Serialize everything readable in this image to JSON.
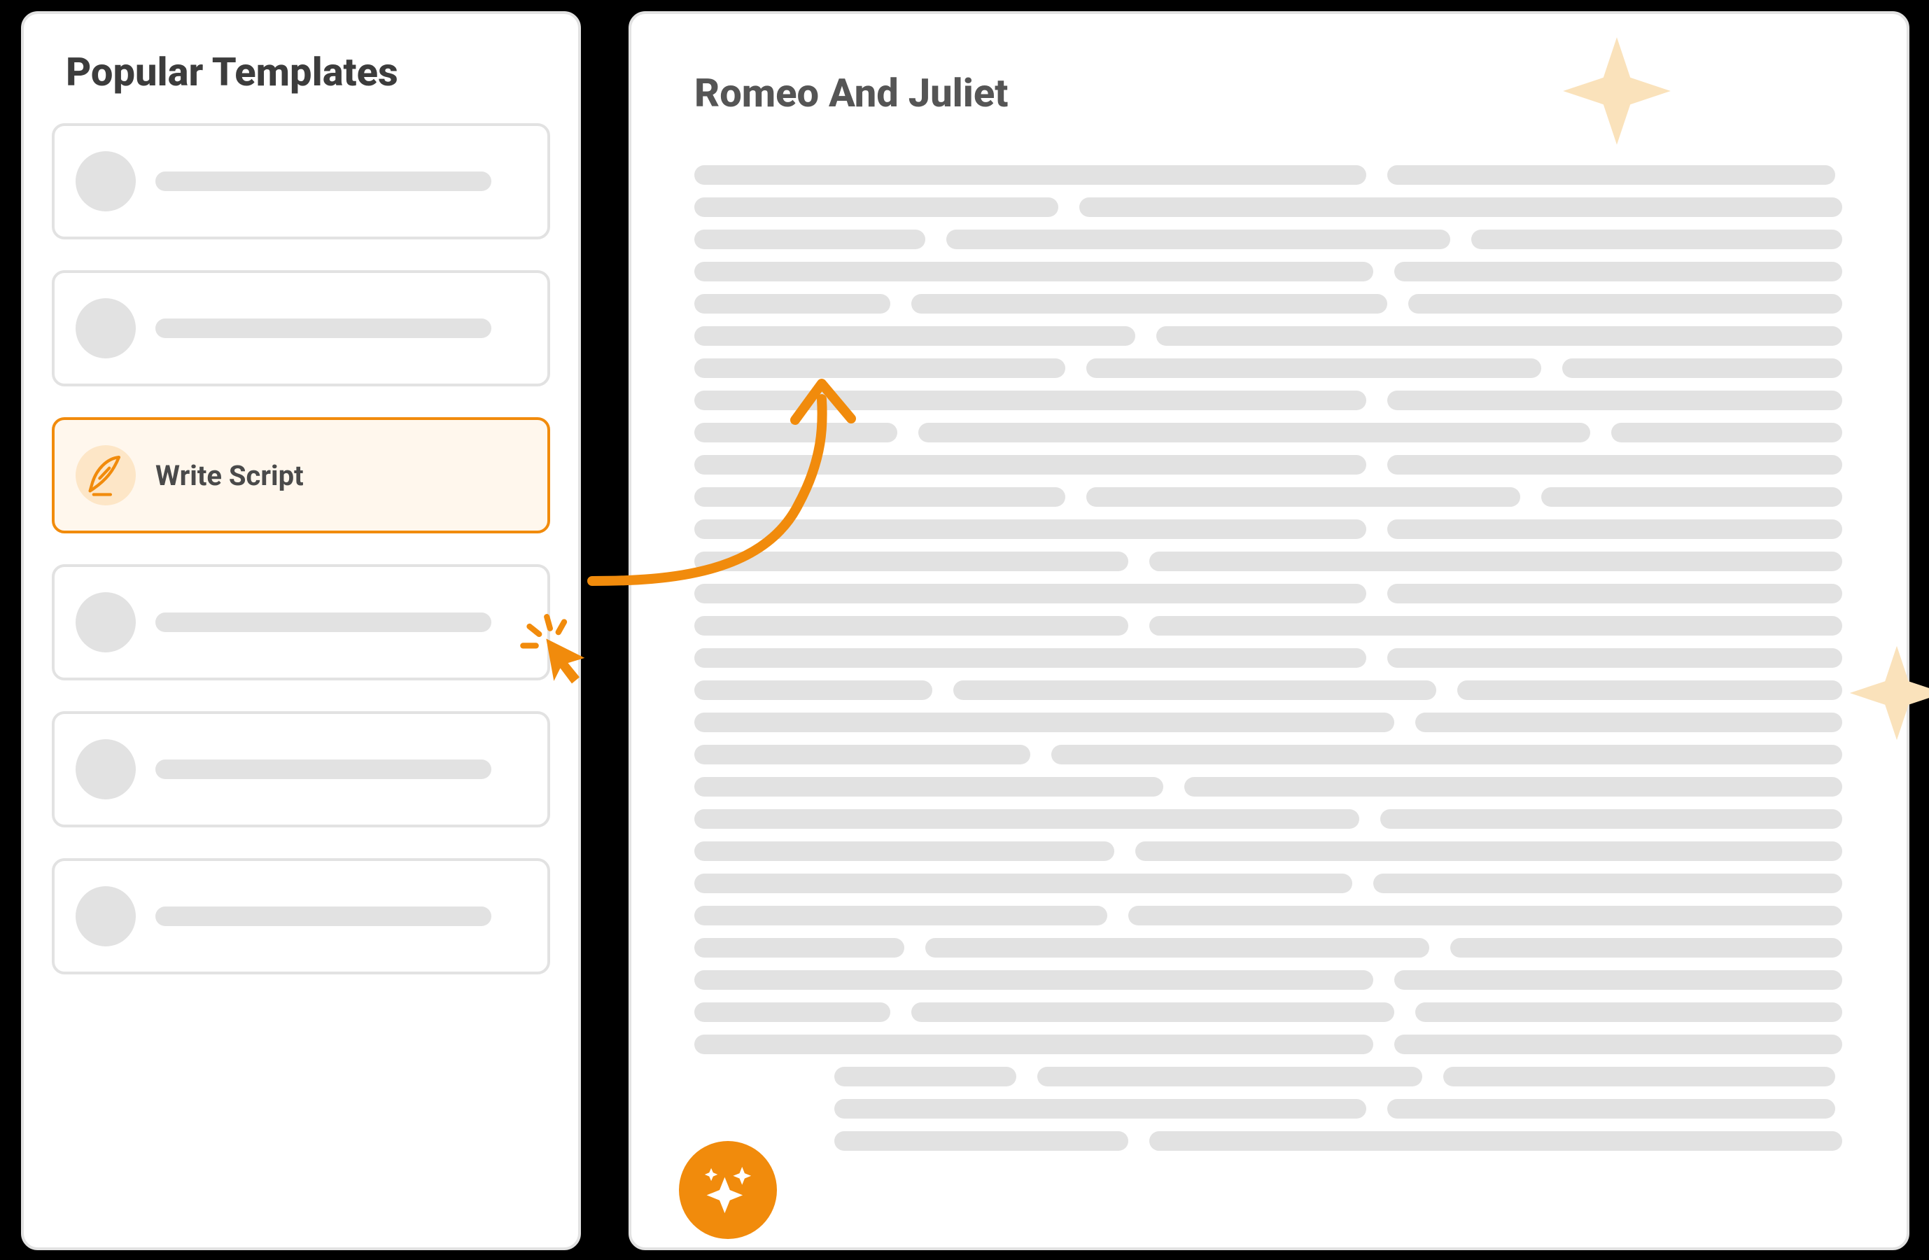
{
  "colors": {
    "orange": "#f18b0c",
    "orange_light": "#fff7ed",
    "orange_soft": "#fde6c7",
    "sparkle": "#fae2bb",
    "gray_line": "#e2e2e2",
    "text_dark": "#3c3c3c",
    "text_mid": "#555555"
  },
  "sidebar": {
    "title": "Popular Templates",
    "items": [
      {
        "label": "",
        "selected": false
      },
      {
        "label": "",
        "selected": false
      },
      {
        "label": "Write Script",
        "selected": true
      },
      {
        "label": "",
        "selected": false
      },
      {
        "label": "",
        "selected": false
      },
      {
        "label": "",
        "selected": false
      }
    ]
  },
  "document": {
    "title": "Romeo And Juliet"
  }
}
